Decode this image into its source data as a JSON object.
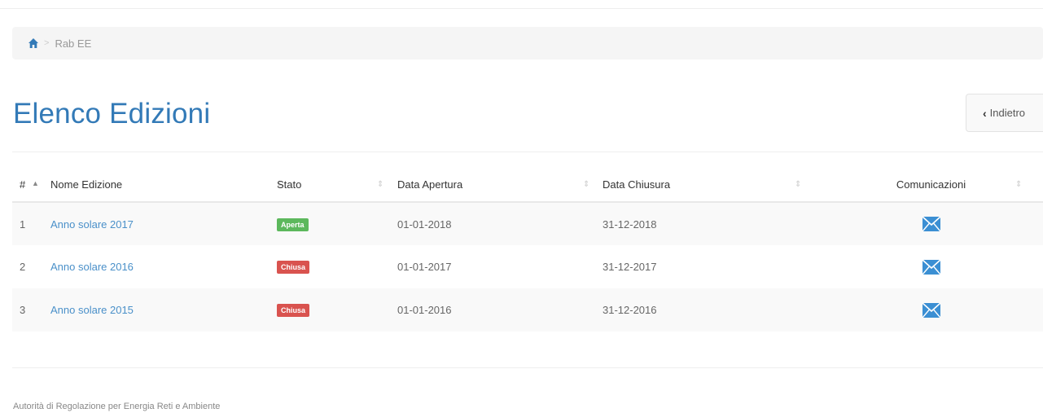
{
  "breadcrumb": {
    "home_icon": "home-icon",
    "separator": ">",
    "current": "Rab EE"
  },
  "page": {
    "title": "Elenco Edizioni",
    "back_label": "Indietro"
  },
  "table": {
    "headers": {
      "num": "#",
      "name": "Nome Edizione",
      "stato": "Stato",
      "apertura": "Data Apertura",
      "chiusura": "Data Chiusura",
      "comunicazioni": "Comunicazioni"
    },
    "rows": [
      {
        "num": "1",
        "name": "Anno solare 2017",
        "stato": "Aperta",
        "apertura": "01-01-2018",
        "chiusura": "31-12-2018"
      },
      {
        "num": "2",
        "name": "Anno solare 2016",
        "stato": "Chiusa",
        "apertura": "01-01-2017",
        "chiusura": "31-12-2017"
      },
      {
        "num": "3",
        "name": "Anno solare 2015",
        "stato": "Chiusa",
        "apertura": "01-01-2016",
        "chiusura": "31-12-2016"
      }
    ]
  },
  "colors": {
    "accent": "#337ab7",
    "open": "#5cb85c",
    "closed": "#d9534f",
    "mail": "#3b8fd3"
  },
  "footer": {
    "text": "Autorità di Regolazione per Energia Reti e Ambiente"
  }
}
